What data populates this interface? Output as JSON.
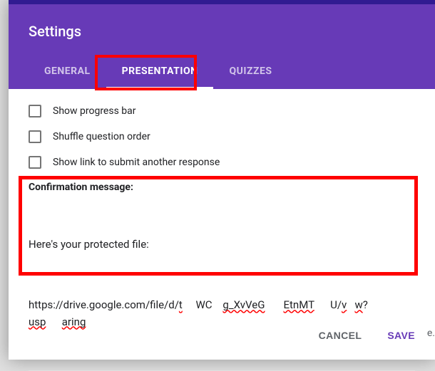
{
  "dialog": {
    "title": "Settings",
    "tabs": [
      {
        "label": "General"
      },
      {
        "label": "Presentation"
      },
      {
        "label": "Quizzes"
      }
    ],
    "active_tab_index": 1
  },
  "presentation": {
    "options": [
      {
        "label": "Show progress bar",
        "checked": false
      },
      {
        "label": "Shuffle question order",
        "checked": false
      },
      {
        "label": "Show link to submit another response",
        "checked": false
      }
    ],
    "confirmation_label": "Confirmation message:",
    "confirmation_message_line1": "Here's your protected file:",
    "confirmation_message_line2_parts": {
      "p1": "https://drive.google.com/file/d/",
      "s1": "t",
      "gap1": "     ",
      "p2": "WC",
      "gap2": "    ",
      "s2": "g_XvVeG",
      "gap3": "       ",
      "s3": "EtnMT",
      "gap4": "      ",
      "p3": "U/",
      "s4": "v",
      "gap5": "   ",
      "s5": "w",
      "p4": "?",
      "s6": "usp",
      "gap6": "      ",
      "s7": "aring"
    }
  },
  "footer": {
    "cancel_label": "Cancel",
    "save_label": "Save"
  },
  "annotations": {
    "tab_highlight": true,
    "confirmation_highlight": true
  },
  "background_char": "e."
}
